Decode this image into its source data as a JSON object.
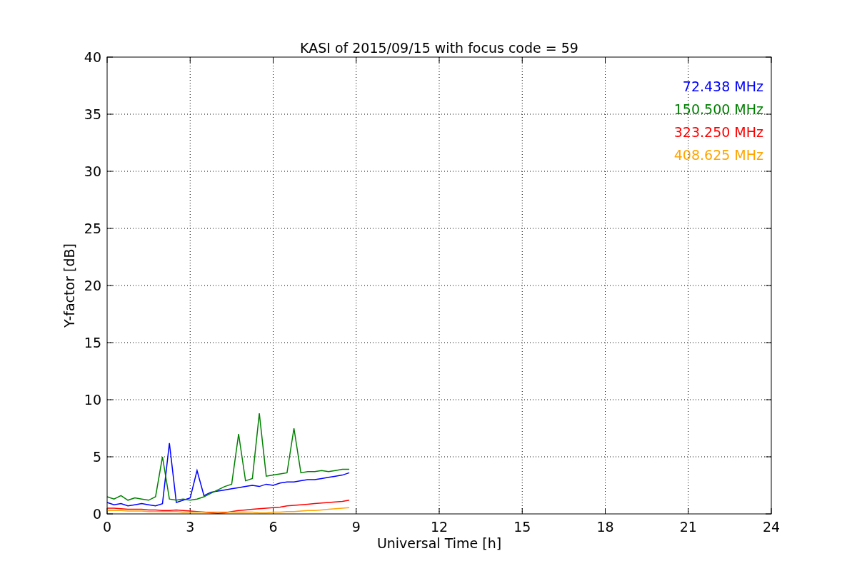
{
  "chart_data": {
    "type": "line",
    "title": "KASI of 2015/09/15 with focus code = 59",
    "xlabel": "Universal Time [h]",
    "ylabel": "Y-factor [dB]",
    "x": [
      0,
      0.25,
      0.5,
      0.75,
      1,
      1.25,
      1.5,
      1.75,
      2,
      2.25,
      2.5,
      2.75,
      3,
      3.25,
      3.5,
      3.75,
      4,
      4.25,
      4.5,
      4.75,
      5,
      5.25,
      5.5,
      5.75,
      6,
      6.25,
      6.5,
      6.75,
      7,
      7.25,
      7.5,
      7.75,
      8,
      8.25,
      8.5,
      8.75
    ],
    "series": [
      {
        "name": "72.438 MHz",
        "color": "#0000ff",
        "values": [
          1.0,
          0.8,
          0.9,
          0.7,
          0.8,
          0.9,
          0.8,
          0.7,
          0.9,
          6.2,
          1.0,
          1.2,
          1.4,
          3.8,
          1.6,
          1.9,
          2.0,
          2.1,
          2.2,
          2.3,
          2.4,
          2.5,
          2.4,
          2.6,
          2.5,
          2.7,
          2.8,
          2.8,
          2.9,
          3.0,
          3.0,
          3.1,
          3.2,
          3.3,
          3.4,
          3.6
        ]
      },
      {
        "name": "150.500 MHz",
        "color": "#008000",
        "values": [
          1.5,
          1.3,
          1.6,
          1.2,
          1.4,
          1.3,
          1.2,
          1.5,
          5.0,
          1.3,
          1.2,
          1.3,
          1.2,
          1.3,
          1.5,
          1.8,
          2.1,
          2.4,
          2.6,
          7.0,
          2.9,
          3.1,
          8.8,
          3.3,
          3.4,
          3.5,
          3.6,
          7.5,
          3.6,
          3.7,
          3.7,
          3.8,
          3.7,
          3.8,
          3.9,
          3.9
        ]
      },
      {
        "name": "323.250 MHz",
        "color": "#ff0000",
        "values": [
          0.5,
          0.5,
          0.45,
          0.4,
          0.4,
          0.4,
          0.35,
          0.35,
          0.3,
          0.3,
          0.35,
          0.3,
          0.25,
          0.2,
          0.15,
          0.1,
          0.05,
          0.1,
          0.2,
          0.3,
          0.35,
          0.4,
          0.45,
          0.5,
          0.55,
          0.6,
          0.7,
          0.75,
          0.8,
          0.85,
          0.9,
          0.95,
          1.0,
          1.05,
          1.1,
          1.2
        ]
      },
      {
        "name": "408.625 MHz",
        "color": "#ffa500",
        "values": [
          0.3,
          0.3,
          0.3,
          0.25,
          0.25,
          0.25,
          0.2,
          0.2,
          0.2,
          0.2,
          0.2,
          0.15,
          0.15,
          0.15,
          0.15,
          0.15,
          0.15,
          0.15,
          0.15,
          0.15,
          0.15,
          0.15,
          0.1,
          0.1,
          0.15,
          0.15,
          0.2,
          0.2,
          0.25,
          0.3,
          0.3,
          0.35,
          0.4,
          0.45,
          0.5,
          0.55
        ]
      }
    ],
    "grid": true,
    "xlim": [
      0,
      24
    ],
    "ylim": [
      0,
      40
    ],
    "xticks": [
      0,
      3,
      6,
      9,
      12,
      15,
      18,
      21,
      24
    ],
    "yticks": [
      0,
      5,
      10,
      15,
      20,
      25,
      30,
      35,
      40
    ]
  }
}
